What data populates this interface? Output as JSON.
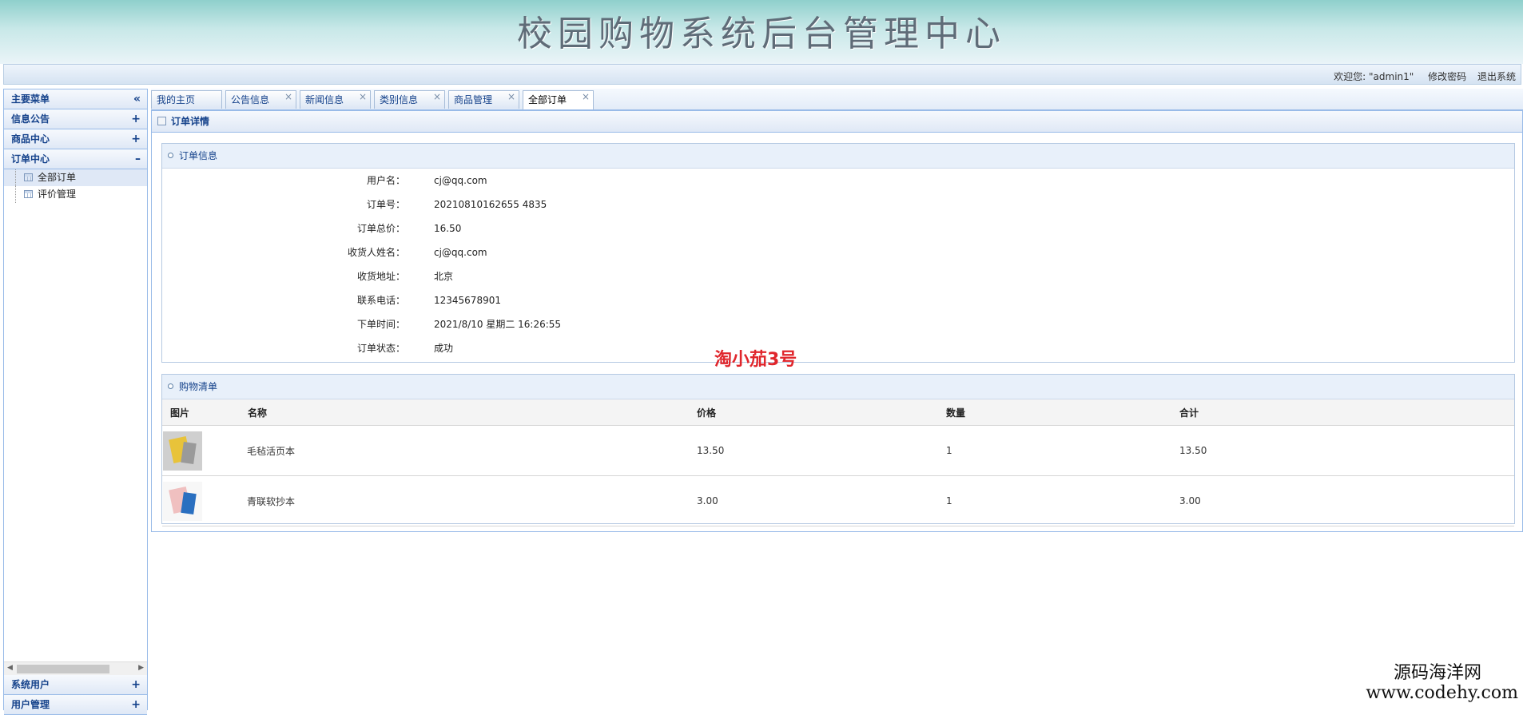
{
  "header": {
    "title": "校园购物系统后台管理中心"
  },
  "topbar": {
    "welcome": "欢迎您: \"admin1\"",
    "change_password": "修改密码",
    "logout": "退出系统"
  },
  "sidebar": {
    "main_menu": {
      "label": "主要菜单",
      "tool": "«"
    },
    "groups": [
      {
        "label": "信息公告",
        "tool": "+"
      },
      {
        "label": "商品中心",
        "tool": "+"
      },
      {
        "label": "订单中心",
        "tool": "–"
      }
    ],
    "order_items": [
      {
        "label": "全部订单",
        "selected": true
      },
      {
        "label": "评价管理",
        "selected": false
      }
    ],
    "bottom_groups": [
      {
        "label": "系统用户",
        "tool": "+"
      },
      {
        "label": "用户管理",
        "tool": "+"
      }
    ]
  },
  "tabs": [
    {
      "label": "我的主页",
      "closable": false,
      "active": false
    },
    {
      "label": "公告信息",
      "closable": true,
      "active": false
    },
    {
      "label": "新闻信息",
      "closable": true,
      "active": false
    },
    {
      "label": "类别信息",
      "closable": true,
      "active": false
    },
    {
      "label": "商品管理",
      "closable": true,
      "active": false
    },
    {
      "label": "全部订单",
      "closable": true,
      "active": true
    }
  ],
  "detail": {
    "title": "订单详情",
    "order_info": {
      "title": "订单信息",
      "fields": [
        {
          "label": "用户名：",
          "value": "cj@qq.com"
        },
        {
          "label": "订单号：",
          "value": "20210810162655 4835"
        },
        {
          "label": "订单总价：",
          "value": "16.50"
        },
        {
          "label": "收货人姓名：",
          "value": "cj@qq.com"
        },
        {
          "label": "收货地址：",
          "value": "北京"
        },
        {
          "label": "联系电话：",
          "value": "12345678901"
        },
        {
          "label": "下单时间：",
          "value": "2021/8/10 星期二 16:26:55"
        },
        {
          "label": "订单状态：",
          "value": "成功"
        }
      ]
    },
    "cart": {
      "title": "购物清单",
      "columns": [
        "图片",
        "名称",
        "价格",
        "数量",
        "合计"
      ],
      "rows": [
        {
          "name": "毛毡活页本",
          "price": "13.50",
          "qty": "1",
          "total": "13.50",
          "img_colors": [
            "#cfcfcf",
            "#e8c33a",
            "#9a9a9a"
          ]
        },
        {
          "name": "青联软抄本",
          "price": "3.00",
          "qty": "1",
          "total": "3.00",
          "img_colors": [
            "#f7f7f7",
            "#f0c0c0",
            "#2a6fc0"
          ]
        }
      ]
    }
  },
  "watermark": "淘小茄3号",
  "brand": {
    "line1": "源码海洋网",
    "line2": "www.codehy.com"
  }
}
